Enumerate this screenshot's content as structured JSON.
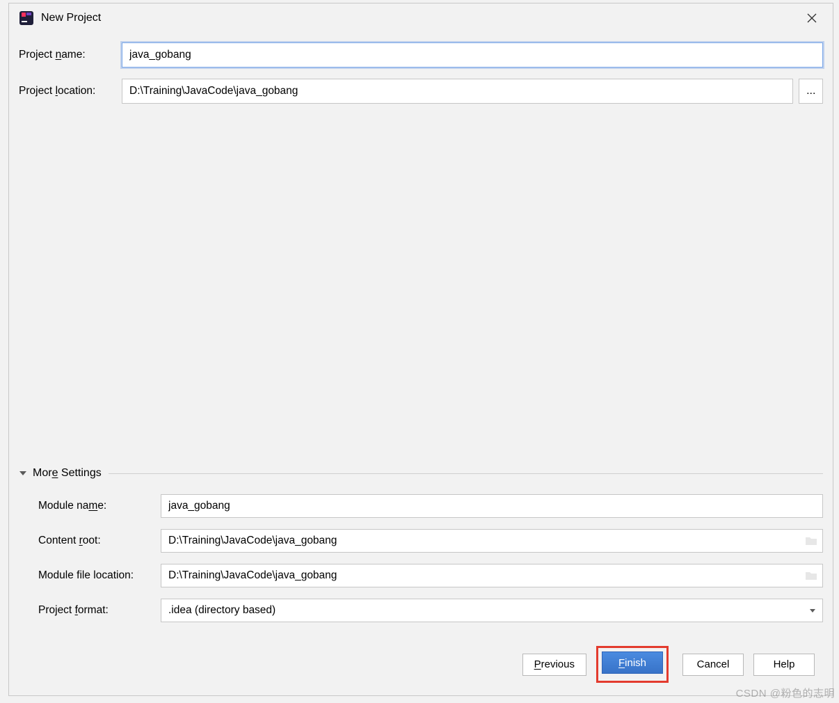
{
  "title": "New Project",
  "fields": {
    "project_name_label_pre": "Project ",
    "project_name_label_u": "n",
    "project_name_label_post": "ame:",
    "project_name_value": "java_gobang",
    "project_location_label_pre": "Project ",
    "project_location_label_u": "l",
    "project_location_label_post": "ocation:",
    "project_location_value": "D:\\Training\\JavaCode\\java_gobang",
    "browse_label": "..."
  },
  "more": {
    "header_pre": "Mor",
    "header_u": "e",
    "header_post": " Settings",
    "module_name_label_pre": "Module na",
    "module_name_label_u": "m",
    "module_name_label_post": "e:",
    "module_name_value": "java_gobang",
    "content_root_label_pre": "Content ",
    "content_root_label_u": "r",
    "content_root_label_post": "oot:",
    "content_root_value": "D:\\Training\\JavaCode\\java_gobang",
    "module_file_label": "Module file location:",
    "module_file_value": "D:\\Training\\JavaCode\\java_gobang",
    "project_format_label_pre": "Project ",
    "project_format_label_u": "f",
    "project_format_label_post": "ormat:",
    "project_format_value": ".idea (directory based)"
  },
  "buttons": {
    "previous_u": "P",
    "previous_post": "revious",
    "finish_u": "F",
    "finish_post": "inish",
    "cancel": "Cancel",
    "help": "Help"
  },
  "watermark": "CSDN @粉色的志明"
}
